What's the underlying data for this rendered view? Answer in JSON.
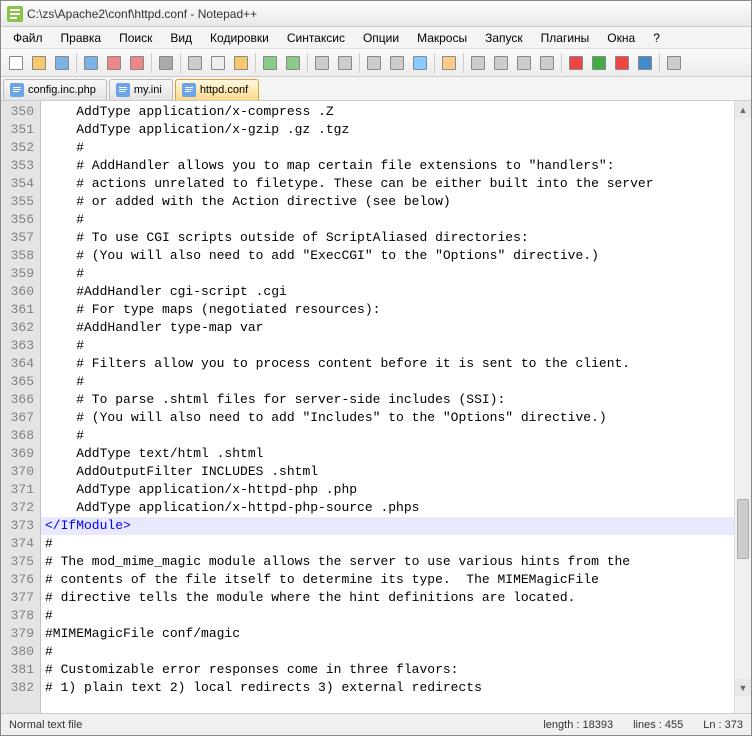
{
  "window": {
    "title": "C:\\zs\\Apache2\\conf\\httpd.conf - Notepad++"
  },
  "menus": [
    "Файл",
    "Правка",
    "Поиск",
    "Вид",
    "Кодировки",
    "Синтаксис",
    "Опции",
    "Макросы",
    "Запуск",
    "Плагины",
    "Окна",
    "?"
  ],
  "tabs": [
    {
      "label": "config.inc.php",
      "active": false
    },
    {
      "label": "my.ini",
      "active": false
    },
    {
      "label": "httpd.conf",
      "active": true
    }
  ],
  "first_line": 350,
  "lines": [
    {
      "text": "    AddType application/x-compress .Z"
    },
    {
      "text": "    AddType application/x-gzip .gz .tgz"
    },
    {
      "text": "    #"
    },
    {
      "text": "    # AddHandler allows you to map certain file extensions to \"handlers\":"
    },
    {
      "text": "    # actions unrelated to filetype. These can be either built into the server"
    },
    {
      "text": "    # or added with the Action directive (see below)"
    },
    {
      "text": "    #"
    },
    {
      "text": "    # To use CGI scripts outside of ScriptAliased directories:"
    },
    {
      "text": "    # (You will also need to add \"ExecCGI\" to the \"Options\" directive.)"
    },
    {
      "text": "    #"
    },
    {
      "text": "    #AddHandler cgi-script .cgi"
    },
    {
      "text": "    # For type maps (negotiated resources):"
    },
    {
      "text": "    #AddHandler type-map var"
    },
    {
      "text": "    #"
    },
    {
      "text": "    # Filters allow you to process content before it is sent to the client."
    },
    {
      "text": "    #"
    },
    {
      "text": "    # To parse .shtml files for server-side includes (SSI):"
    },
    {
      "text": "    # (You will also need to add \"Includes\" to the \"Options\" directive.)"
    },
    {
      "text": "    #"
    },
    {
      "text": "    AddType text/html .shtml",
      "arrow": true
    },
    {
      "text": "    AddOutputFilter INCLUDES .shtml",
      "arrow": true
    },
    {
      "text": "    AddType application/x-httpd-php .php",
      "arrow": true
    },
    {
      "text": "    AddType application/x-httpd-php-source .phps",
      "arrow": true
    },
    {
      "text": "</IfModule>",
      "tag": true,
      "highlight": true
    },
    {
      "text": "#"
    },
    {
      "text": "# The mod_mime_magic module allows the server to use various hints from the"
    },
    {
      "text": "# contents of the file itself to determine its type.  The MIMEMagicFile"
    },
    {
      "text": "# directive tells the module where the hint definitions are located."
    },
    {
      "text": "#"
    },
    {
      "text": "#MIMEMagicFile conf/magic"
    },
    {
      "text": "#"
    },
    {
      "text": "# Customizable error responses come in three flavors:"
    },
    {
      "text": "# 1) plain text 2) local redirects 3) external redirects"
    }
  ],
  "status": {
    "left": "Normal text file",
    "length": "length : 18393",
    "lines": "lines : 455",
    "ln": "Ln : 373"
  },
  "toolbar_icons": [
    "new",
    "open",
    "save",
    "saveall",
    "close",
    "closeall",
    "print",
    "cut",
    "copy",
    "paste",
    "undo",
    "redo",
    "find",
    "replace",
    "zoomin",
    "zoomout",
    "sync",
    "wrap",
    "allchars",
    "indent",
    "guide",
    "lang",
    "macro-rec",
    "macro-play",
    "macro-stop",
    "macro-run",
    "hide"
  ]
}
